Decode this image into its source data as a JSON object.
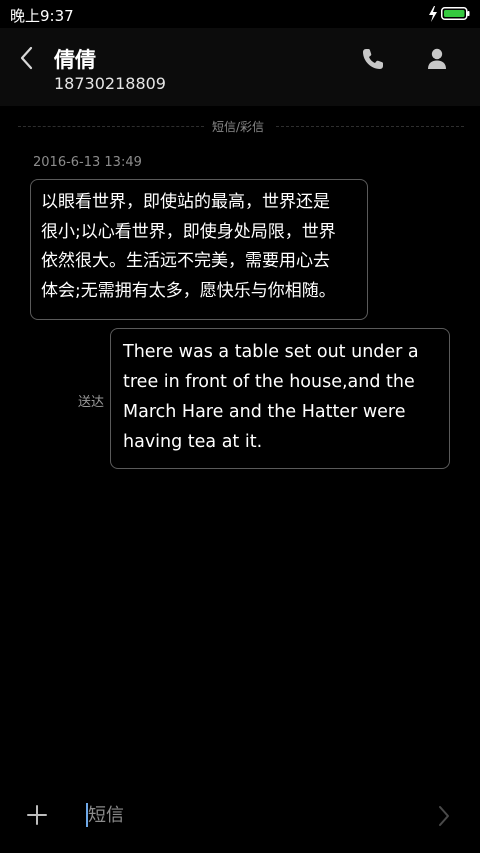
{
  "status_bar": {
    "time": "晚上9:37"
  },
  "header": {
    "contact_name": "倩倩",
    "contact_number": "18730218809",
    "icons": [
      "back-icon",
      "phone-icon",
      "person-icon"
    ]
  },
  "conversation": {
    "channel_label": "短信/彩信",
    "timestamp": "2016-6-13 13:49",
    "messages": [
      {
        "direction": "incoming",
        "lines": [
          "以眼看世界，即使站的最高，世界还是",
          "很小;以心看世界，即使身处局限，世界",
          "依然很大。生活远不完美，需要用心去",
          "体会;无需拥有太多，愿快乐与你相随。"
        ]
      },
      {
        "direction": "outgoing",
        "status": "送达",
        "lines": [
          "There was a table set out under a",
          "tree in front of the house,and the",
          "March Hare and the Hatter were",
          "having tea at it."
        ]
      }
    ]
  },
  "composer": {
    "placeholder": "短信",
    "icons": [
      "plus-icon",
      "send-icon"
    ]
  },
  "colors": {
    "background": "#000000",
    "battery_accent": "#35c93f",
    "cursor": "#6fa9e8"
  }
}
